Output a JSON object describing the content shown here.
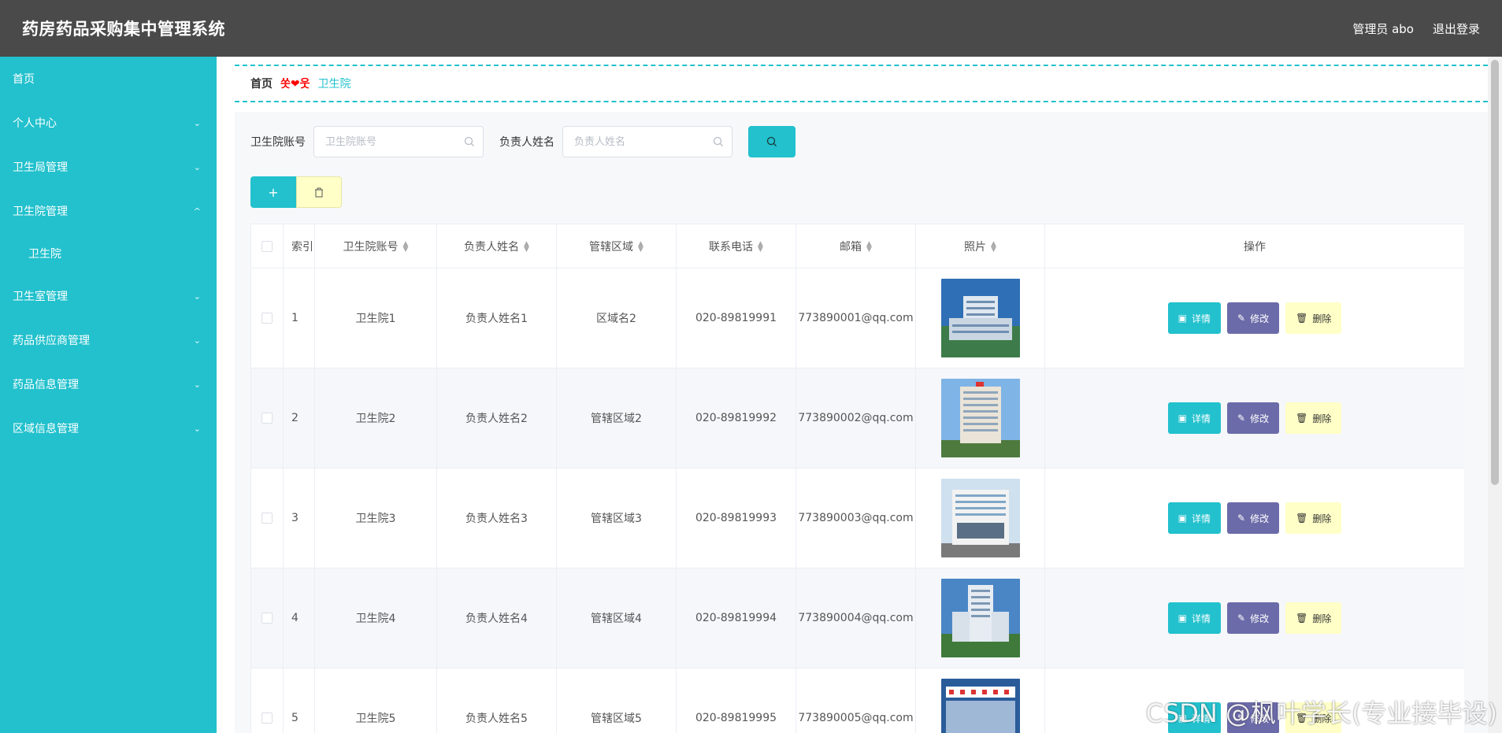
{
  "header": {
    "title": "药房药品采购集中管理系统",
    "user": "管理员 abo",
    "logout": "退出登录"
  },
  "sidebar": {
    "items": [
      {
        "label": "首页"
      },
      {
        "label": "个人中心",
        "chevron": "chevron-down-icon"
      },
      {
        "label": "卫生局管理",
        "chevron": "chevron-down-icon"
      },
      {
        "label": "卫生院管理",
        "chevron": "chevron-up-icon"
      },
      {
        "label": "卫生院"
      },
      {
        "label": "卫生室管理",
        "chevron": "chevron-down-icon"
      },
      {
        "label": "药品供应商管理",
        "chevron": "chevron-down-icon"
      },
      {
        "label": "药品信息管理",
        "chevron": "chevron-down-icon"
      },
      {
        "label": "区域信息管理",
        "chevron": "chevron-down-icon"
      }
    ]
  },
  "breadcrumb": {
    "home": "首页",
    "separator": "쏫❤웃",
    "current": "卫生院"
  },
  "search": {
    "account_label": "卫生院账号",
    "account_placeholder": "卫生院账号",
    "account_value": "",
    "leader_label": "负责人姓名",
    "leader_placeholder": "负责人姓名",
    "leader_value": ""
  },
  "actions": {
    "add": "+",
    "delete_icon": "trash-icon"
  },
  "table": {
    "columns": [
      "索引",
      "卫生院账号",
      "负责人姓名",
      "管辖区域",
      "联系电话",
      "邮箱",
      "照片",
      "操作"
    ],
    "rows": [
      {
        "index": "1",
        "account": "卫生院1",
        "leader": "负责人姓名1",
        "area": "区域名2",
        "phone": "020-89819991",
        "email": "773890001@qq.com"
      },
      {
        "index": "2",
        "account": "卫生院2",
        "leader": "负责人姓名2",
        "area": "管辖区域2",
        "phone": "020-89819992",
        "email": "773890002@qq.com"
      },
      {
        "index": "3",
        "account": "卫生院3",
        "leader": "负责人姓名3",
        "area": "管辖区域3",
        "phone": "020-89819993",
        "email": "773890003@qq.com"
      },
      {
        "index": "4",
        "account": "卫生院4",
        "leader": "负责人姓名4",
        "area": "管辖区域4",
        "phone": "020-89819994",
        "email": "773890004@qq.com"
      },
      {
        "index": "5",
        "account": "卫生院5",
        "leader": "负责人姓名5",
        "area": "管辖区域5",
        "phone": "020-89819995",
        "email": "773890005@qq.com"
      }
    ],
    "ops": {
      "detail": "详情",
      "edit": "修改",
      "delete": "删除"
    }
  },
  "watermark": "CSDN @枫叶学长(专业接毕设)",
  "colors": {
    "accent": "#22c1cd",
    "header": "#4a4a4a",
    "edit": "#6c6ba9",
    "delete": "#ffffc7"
  }
}
